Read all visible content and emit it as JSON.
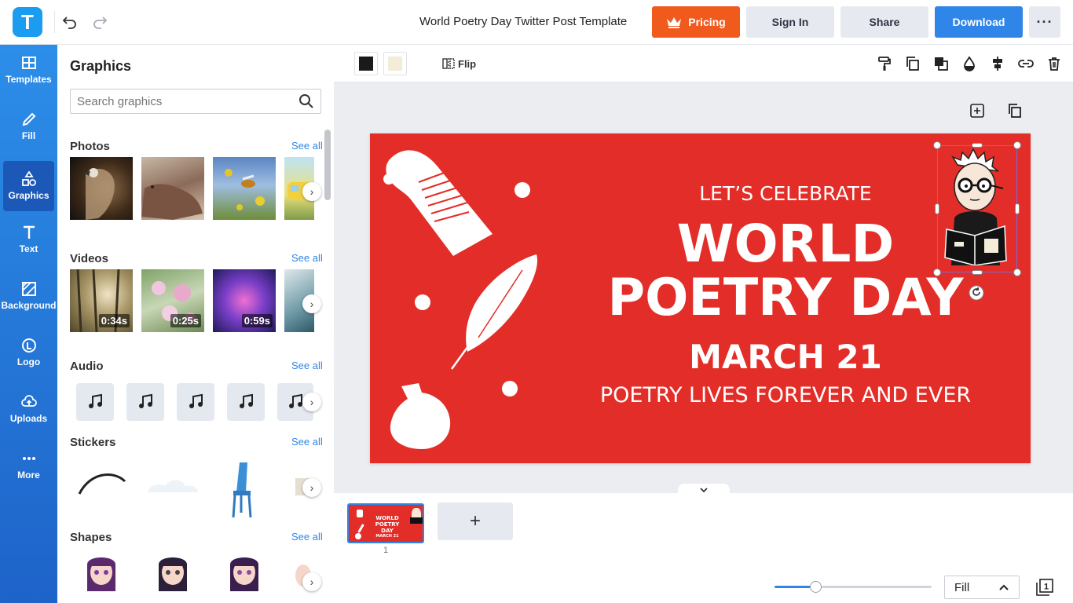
{
  "header": {
    "logo_letter": "T",
    "document_title": "World Poetry Day Twitter Post Template",
    "pricing_label": "Pricing",
    "signin_label": "Sign In",
    "share_label": "Share",
    "download_label": "Download",
    "more_label": "···"
  },
  "nav": {
    "items": [
      {
        "label": "Templates",
        "icon": "templates-icon"
      },
      {
        "label": "Fill",
        "icon": "pencil-icon"
      },
      {
        "label": "Graphics",
        "icon": "shapes-icon"
      },
      {
        "label": "Text",
        "icon": "text-icon"
      },
      {
        "label": "Background",
        "icon": "background-icon"
      },
      {
        "label": "Logo",
        "icon": "logo-icon"
      },
      {
        "label": "Uploads",
        "icon": "upload-cloud-icon"
      },
      {
        "label": "More",
        "icon": "more-icon"
      }
    ],
    "active": "Graphics"
  },
  "panel": {
    "title": "Graphics",
    "search_placeholder": "Search graphics",
    "see_all": "See all",
    "sections": {
      "photos": "Photos",
      "videos": "Videos",
      "audio": "Audio",
      "stickers": "Stickers",
      "shapes": "Shapes"
    },
    "video_durations": [
      "0:34s",
      "0:25s",
      "0:59s"
    ]
  },
  "toolbar": {
    "flip_label": "Flip",
    "swatch_colors": [
      "#1a1a1a",
      "#f3ecd8"
    ]
  },
  "canvas": {
    "background": "#e32d28",
    "line1": "LET’S CELEBRATE",
    "line2": "WORLD",
    "line3": "POETRY DAY",
    "line4": "MARCH 21",
    "line5": "POETRY LIVES FOREVER AND EVER"
  },
  "thumbnail": {
    "line2": "WORLD",
    "line3": "POETRY DAY",
    "line4": "MARCH 21"
  },
  "pages": {
    "current": "1",
    "add_label": "+"
  },
  "zoom": {
    "fit_label": "Fill",
    "slider_fraction": 0.26
  },
  "colors": {
    "accent": "#2f86e8",
    "pricing": "#f05a1d",
    "nav_top": "#2c8ee8",
    "nav_bottom": "#1e63c9"
  }
}
